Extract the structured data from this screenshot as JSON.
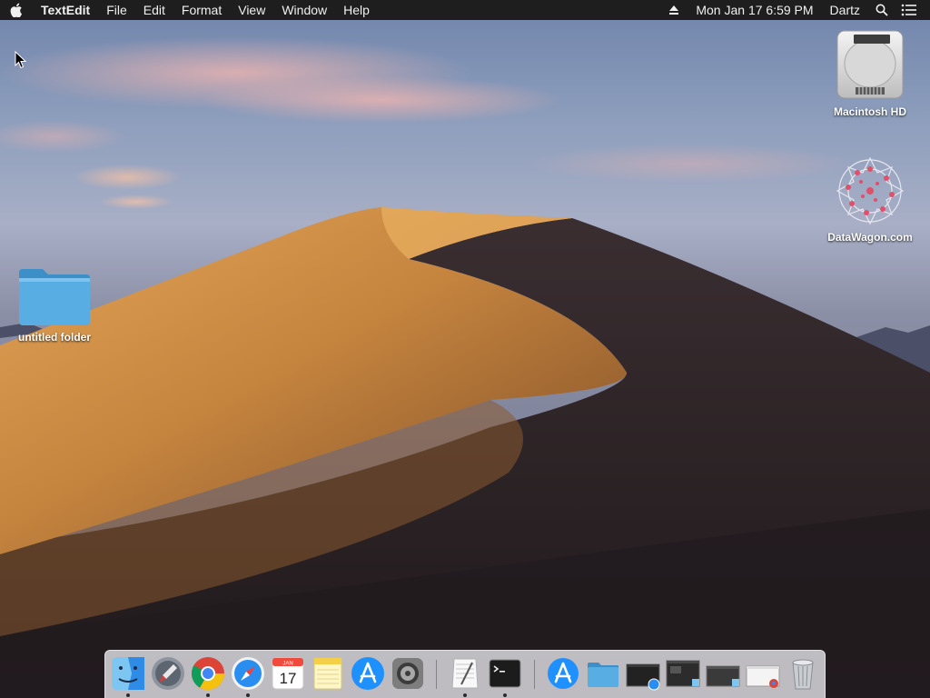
{
  "menubar": {
    "apple_icon": "apple-logo-icon",
    "app_name": "TextEdit",
    "menus": [
      "File",
      "Edit",
      "Format",
      "View",
      "Window",
      "Help"
    ],
    "status": {
      "eject_icon": "eject-icon",
      "clock": "Mon Jan 17  6:59 PM",
      "user": "Dartz",
      "spotlight_icon": "search-icon",
      "notifications_icon": "list-icon"
    }
  },
  "desktop": {
    "icons": [
      {
        "label": "Macintosh HD",
        "icon": "hard-drive-icon"
      },
      {
        "label": "DataWagon.com",
        "icon": "datawagon-logo-icon"
      },
      {
        "label": "untitled folder",
        "icon": "folder-icon"
      }
    ]
  },
  "dock": {
    "items": [
      {
        "name": "Finder",
        "icon": "finder-icon",
        "running": true
      },
      {
        "name": "Launchpad",
        "icon": "launchpad-icon",
        "running": false
      },
      {
        "name": "Google Chrome",
        "icon": "chrome-icon",
        "running": true
      },
      {
        "name": "Safari",
        "icon": "safari-icon",
        "running": true
      },
      {
        "name": "Calendar",
        "icon": "calendar-icon",
        "running": false,
        "month": "JAN",
        "day": "17"
      },
      {
        "name": "Notes",
        "icon": "notes-icon",
        "running": false
      },
      {
        "name": "App Store",
        "icon": "app-store-icon",
        "running": false
      },
      {
        "name": "System Preferences",
        "icon": "system-preferences-icon",
        "running": false
      },
      {
        "name": "TextEdit",
        "icon": "textedit-icon",
        "running": true
      },
      {
        "name": "Terminal",
        "icon": "terminal-icon",
        "running": true
      },
      {
        "name": "Downloads",
        "icon": "app-store-stack-icon",
        "running": false
      },
      {
        "name": "Documents",
        "icon": "folder-stack-icon",
        "running": false
      },
      {
        "name": "Minimized Safari window",
        "icon": "minimized-window-icon",
        "running": false
      },
      {
        "name": "Minimized Finder window",
        "icon": "minimized-window-icon",
        "running": false
      },
      {
        "name": "Minimized Finder window 2",
        "icon": "minimized-window-icon",
        "running": false
      },
      {
        "name": "Minimized Chrome window",
        "icon": "minimized-window-icon",
        "running": false
      },
      {
        "name": "Trash",
        "icon": "trash-icon",
        "running": false
      }
    ]
  },
  "colors": {
    "menubar_bg": "#1e1e1e",
    "folder_blue": "#4aa8e0",
    "sand_light": "#d99a4e",
    "sand_dark": "#2a2226"
  }
}
